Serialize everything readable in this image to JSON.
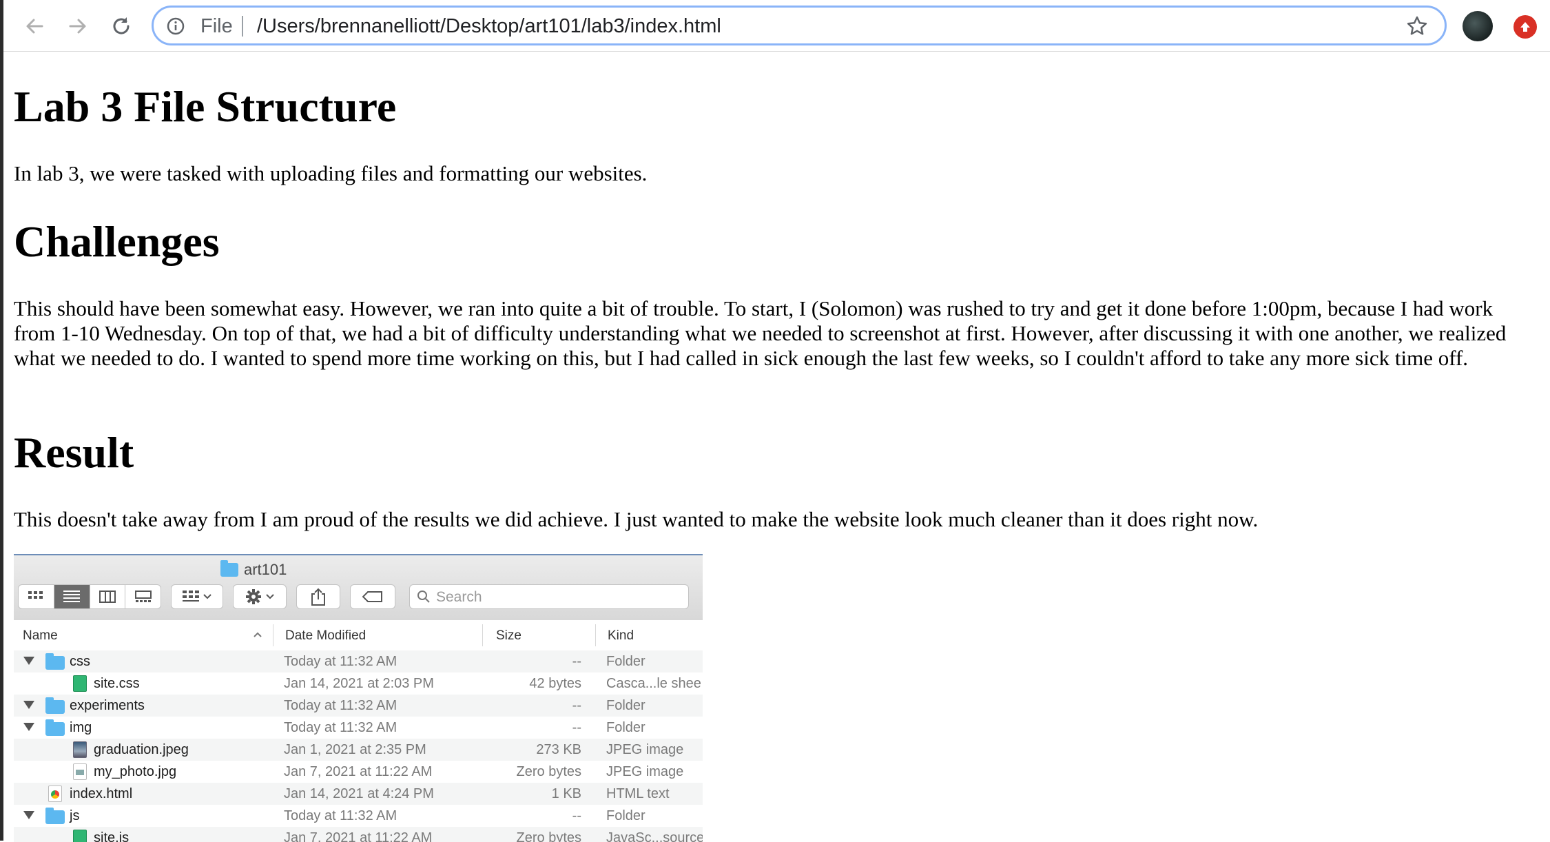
{
  "browser": {
    "scheme_label": "File",
    "url": "/Users/brennanelliott/Desktop/art101/lab3/index.html",
    "icons": [
      "back-icon",
      "forward-icon",
      "reload-icon",
      "info-icon",
      "star-icon",
      "avatar",
      "update-icon"
    ]
  },
  "page": {
    "heading1": "Lab 3 File Structure",
    "intro": "In lab 3, we were tasked with uploading files and formatting our websites.",
    "heading2": "Challenges",
    "challenges_text": "This should have been somewhat easy. However, we ran into quite a bit of trouble. To start, I (Solomon) was rushed to try and get it done before 1:00pm, because I had work from 1-10 Wednesday. On top of that, we had a bit of difficulty understanding what we needed to screenshot at first. However, after discussing it with one another, we realized what we needed to do. I wanted to spend more time working on this, but I had called in sick enough the last few weeks, so I couldn't afford to take any more sick time off.",
    "heading3": "Result",
    "result_text": "This doesn't take away from I am proud of the results we did achieve. I just wanted to make the website look much cleaner than it does right now."
  },
  "finder": {
    "title": "art101",
    "search_placeholder": "Search",
    "columns": {
      "name": "Name",
      "date": "Date Modified",
      "size": "Size",
      "kind": "Kind"
    },
    "rows": [
      {
        "name": "css",
        "date": "Today at 11:32 AM",
        "size": "--",
        "kind": "Folder"
      },
      {
        "name": "site.css",
        "date": "Jan 14, 2021 at 2:03 PM",
        "size": "42 bytes",
        "kind": "Casca...le shee"
      },
      {
        "name": "experiments",
        "date": "Today at 11:32 AM",
        "size": "--",
        "kind": "Folder"
      },
      {
        "name": "img",
        "date": "Today at 11:32 AM",
        "size": "--",
        "kind": "Folder"
      },
      {
        "name": "graduation.jpeg",
        "date": "Jan 1, 2021 at 2:35 PM",
        "size": "273 KB",
        "kind": "JPEG image"
      },
      {
        "name": "my_photo.jpg",
        "date": "Jan 7, 2021 at 11:22 AM",
        "size": "Zero bytes",
        "kind": "JPEG image"
      },
      {
        "name": "index.html",
        "date": "Jan 14, 2021 at 4:24 PM",
        "size": "1 KB",
        "kind": "HTML text"
      },
      {
        "name": "js",
        "date": "Today at 11:32 AM",
        "size": "--",
        "kind": "Folder"
      },
      {
        "name": "site.js",
        "date": "Jan 7, 2021 at 11:22 AM",
        "size": "Zero bytes",
        "kind": "JavaSc...source"
      }
    ]
  }
}
